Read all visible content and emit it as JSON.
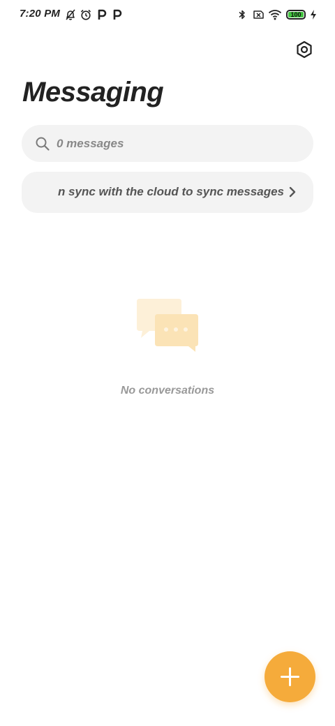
{
  "status_bar": {
    "time": "7:20 PM",
    "battery_level": "100",
    "battery_fraction": 1.0,
    "icons": [
      "muted-bell-icon",
      "alarm-clock-icon",
      "parking-icon",
      "parking-icon",
      "bluetooth-icon",
      "no-sim-icon",
      "wifi-icon",
      "battery-icon",
      "charging-bolt-icon"
    ]
  },
  "header": {
    "title": "Messaging",
    "settings_icon": "settings-hexagon-icon"
  },
  "search": {
    "placeholder": "0 messages",
    "icon": "search-icon"
  },
  "sync_banner": {
    "text": "n sync with the cloud to sync messages",
    "icon": "chevron-right-icon"
  },
  "empty_state": {
    "icon": "chat-bubbles-icon",
    "text": "No conversations"
  },
  "fab": {
    "icon": "plus-icon"
  },
  "colors": {
    "accent": "#f5ab3b",
    "battery_green": "#41c43f",
    "surface": "#f3f3f3",
    "title_text": "#222222",
    "muted_text": "#999999"
  }
}
